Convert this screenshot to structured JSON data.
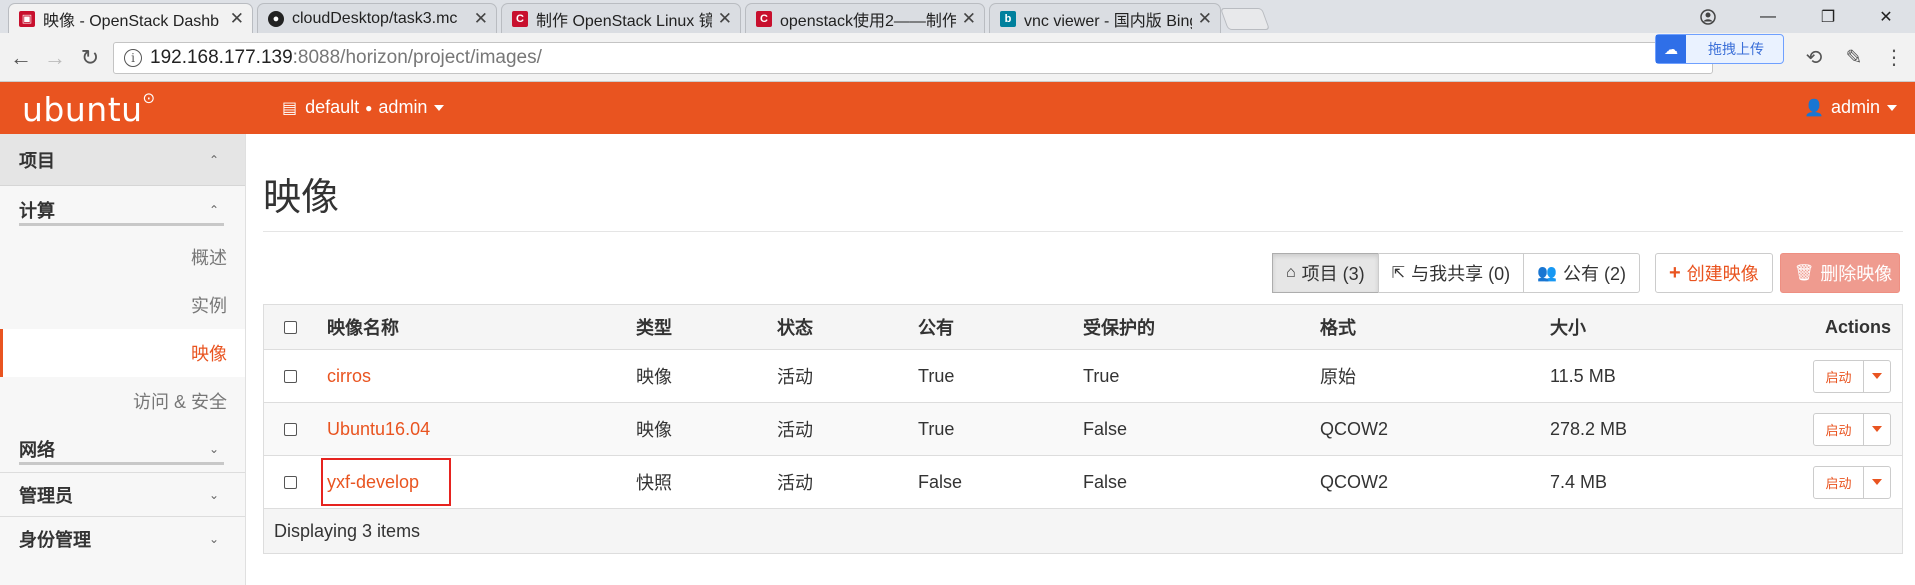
{
  "browser": {
    "tabs": [
      {
        "title": "映像 - OpenStack Dashb",
        "favicon": "openstack-icon",
        "color": "#c8102e",
        "active": true
      },
      {
        "title": "cloudDesktop/task3.mc",
        "favicon": "github-icon",
        "color": "#222222",
        "active": false
      },
      {
        "title": "制作 OpenStack Linux 镜",
        "favicon": "csdn-icon",
        "color": "#c8102e",
        "active": false
      },
      {
        "title": "openstack使用2——制作",
        "favicon": "csdn-icon",
        "color": "#c8102e",
        "active": false
      },
      {
        "title": "vnc viewer - 国内版 Bing",
        "favicon": "bing-icon",
        "color": "#00809d",
        "active": false
      }
    ],
    "url_host": "192.168.177.139",
    "url_path": ":8088/horizon/project/images/",
    "ext_upload_label": "拖拽上传"
  },
  "header": {
    "logo": "ubuntu",
    "logo_mark": "⊙",
    "project": "default",
    "project_user": "admin",
    "user": "admin"
  },
  "sidebar": {
    "project_label": "项目",
    "compute_label": "计算",
    "compute_items": [
      "概述",
      "实例",
      "映像",
      "访问 & 安全"
    ],
    "active_item": "映像",
    "network_label": "网络",
    "admin_label": "管理员",
    "identity_label": "身份管理"
  },
  "main": {
    "title": "映像",
    "filters": [
      {
        "label": "项目 (3)",
        "icon": "home-icon",
        "pressed": true
      },
      {
        "label": "与我共享 (0)",
        "icon": "share-icon",
        "pressed": false
      },
      {
        "label": "公有 (2)",
        "icon": "users-icon",
        "pressed": false
      }
    ],
    "create_label": "创建映像",
    "delete_label": "删除映像",
    "table": {
      "headers": [
        "映像名称",
        "类型",
        "状态",
        "公有",
        "受保护的",
        "格式",
        "大小",
        "Actions"
      ],
      "rows": [
        {
          "name": "cirros",
          "type": "映像",
          "status": "活动",
          "public": "True",
          "protected": "True",
          "format": "原始",
          "size": "11.5 MB",
          "action": "启动"
        },
        {
          "name": "Ubuntu16.04",
          "type": "映像",
          "status": "活动",
          "public": "True",
          "protected": "False",
          "format": "QCOW2",
          "size": "278.2 MB",
          "action": "启动"
        },
        {
          "name": "yxf-develop",
          "type": "快照",
          "status": "活动",
          "public": "False",
          "protected": "False",
          "format": "QCOW2",
          "size": "7.4 MB",
          "action": "启动"
        }
      ],
      "footer": "Displaying 3 items"
    }
  }
}
